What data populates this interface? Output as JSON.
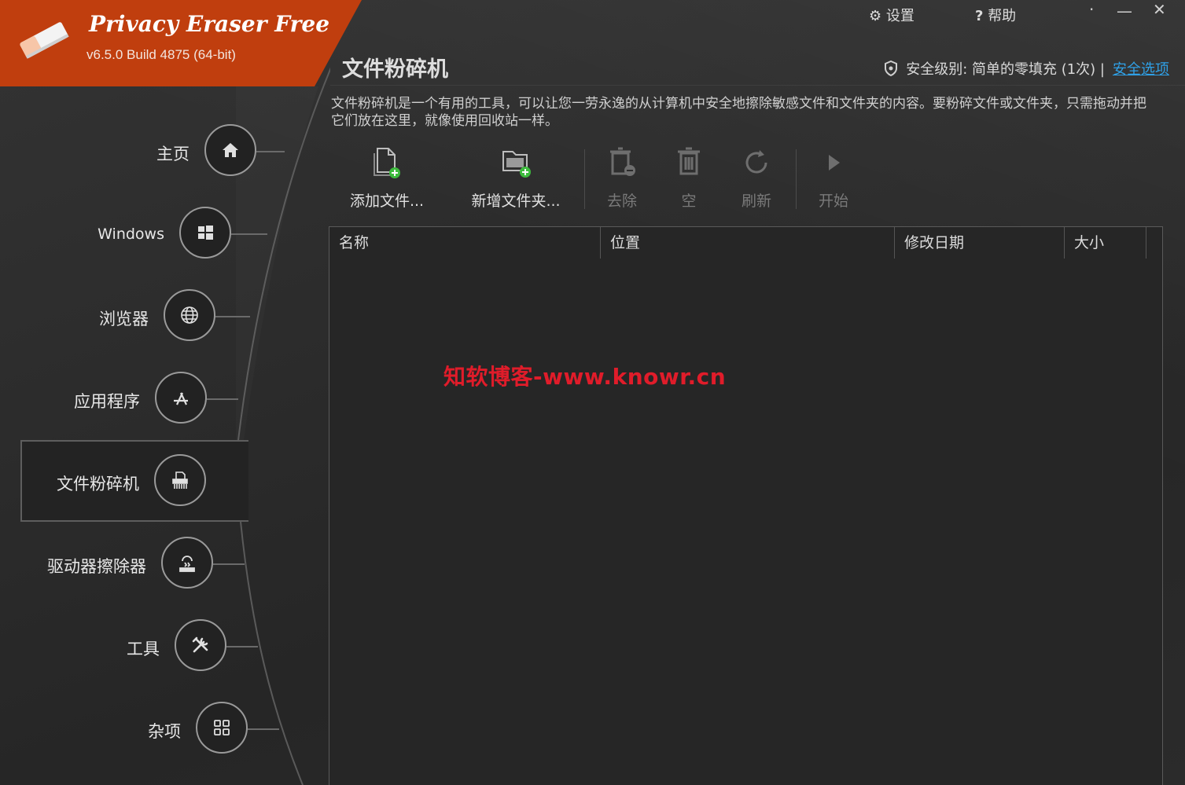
{
  "app": {
    "title": "Privacy Eraser Free",
    "version": "v6.5.0 Build 4875 (64-bit)"
  },
  "topbar": {
    "settings_label": "设置",
    "help_label": "帮助",
    "minimize": "—",
    "close": "✕",
    "dot": "·"
  },
  "sidebar": {
    "items": [
      {
        "label": "主页",
        "icon": "home-icon"
      },
      {
        "label": "Windows",
        "icon": "windows-icon"
      },
      {
        "label": "浏览器",
        "icon": "globe-icon"
      },
      {
        "label": "应用程序",
        "icon": "app-store-icon"
      },
      {
        "label": "文件粉碎机",
        "icon": "shredder-icon",
        "active": true
      },
      {
        "label": "驱动器擦除器",
        "icon": "drive-wipe-icon"
      },
      {
        "label": "工具",
        "icon": "tools-icon"
      },
      {
        "label": "杂项",
        "icon": "grid-icon"
      }
    ]
  },
  "main": {
    "title": "文件粉碎机",
    "security_text": "安全级别: 简单的零填充 (1次) |",
    "security_link": "安全选项",
    "description": "文件粉碎机是一个有用的工具，可以让您一劳永逸的从计算机中安全地擦除敏感文件和文件夹的内容。要粉碎文件或文件夹，只需拖动并把它们放在这里，就像使用回收站一样。",
    "toolbar": {
      "add_file": "添加文件...",
      "add_folder": "新增文件夹...",
      "remove": "去除",
      "empty": "空",
      "refresh": "刷新",
      "start": "开始"
    },
    "table": {
      "columns": [
        "名称",
        "位置",
        "修改日期",
        "大小"
      ],
      "rows": []
    },
    "watermark": "知软博客-www.knowr.cn"
  },
  "colors": {
    "brand": "#c03e0e",
    "link": "#2fa0e6",
    "watermark": "#e01c2a",
    "plus": "#3dbb3d"
  }
}
